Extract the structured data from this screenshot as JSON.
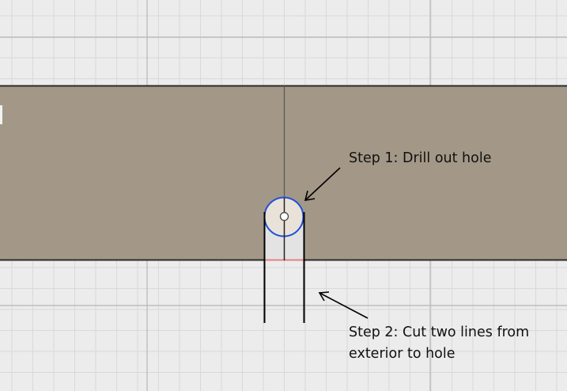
{
  "annotations": {
    "step1": "Step 1: Drill out hole",
    "step2_line1": "Step 2: Cut two lines from",
    "step2_line2": "exterior to hole"
  },
  "colors": {
    "background": "#ececec",
    "grid_minor": "#d9d9d9",
    "grid_major": "#bdbdbd",
    "board": "#a39887",
    "board_edge": "#2b2b2b",
    "hole_outline": "#1f4fd6",
    "hole_fill": "#e9e2d8",
    "cut_line": "#000000",
    "highlight_edge": "#e87f7f",
    "arrow": "#000000"
  }
}
